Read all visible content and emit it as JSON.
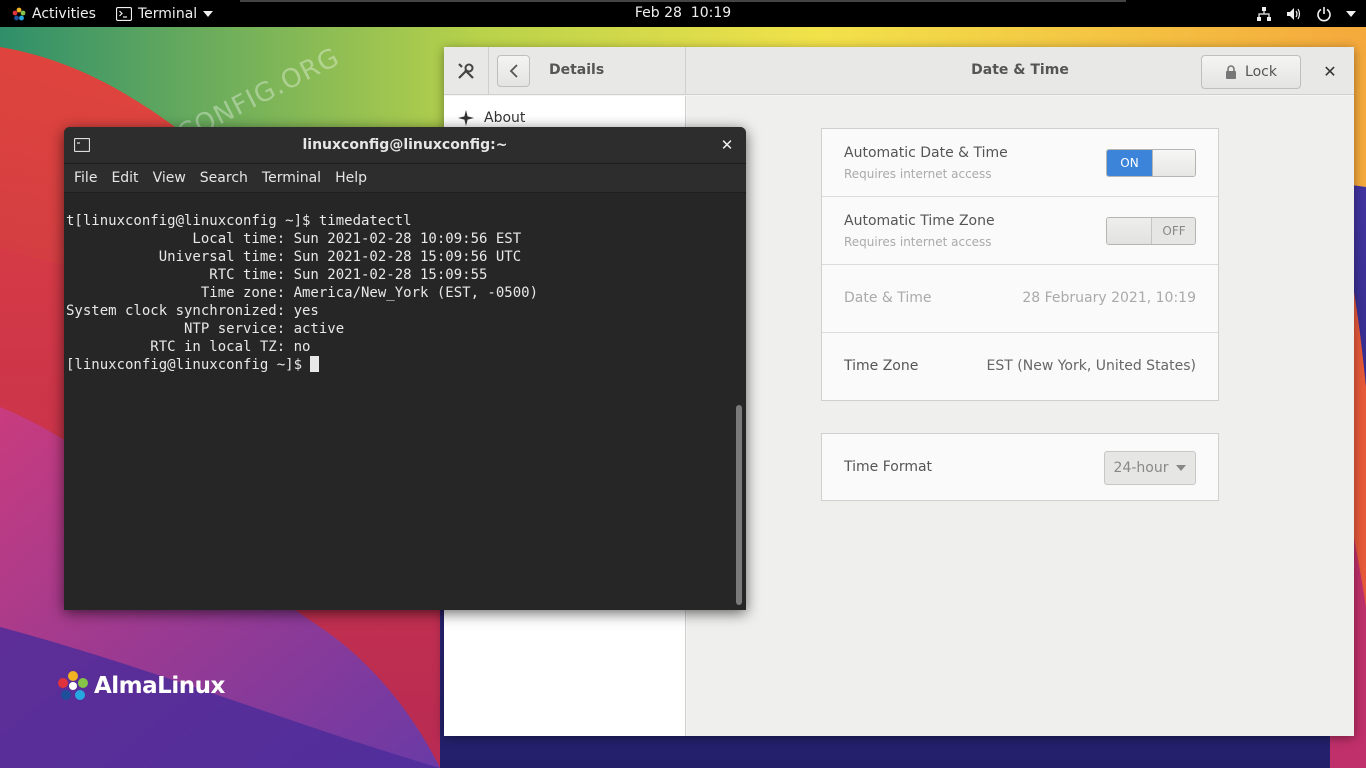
{
  "topbar": {
    "activities_label": "Activities",
    "app_menu_label": "Terminal",
    "clock": "Feb 28  10:19",
    "tray_icons": [
      "network-icon",
      "volume-icon",
      "power-icon"
    ]
  },
  "settings": {
    "sidebar_title": "Details",
    "page_title": "Date & Time",
    "lock_label": "Lock",
    "sidebar_items": [
      {
        "label": "About"
      }
    ],
    "rows": {
      "auto_datetime": {
        "label": "Automatic Date & Time",
        "sub": "Requires internet access",
        "state": "ON"
      },
      "auto_timezone": {
        "label": "Automatic Time Zone",
        "sub": "Requires internet access",
        "state": "OFF"
      },
      "datetime": {
        "label": "Date & Time",
        "value": "28 February 2021, 10:19"
      },
      "timezone": {
        "label": "Time Zone",
        "value": "EST (New York, United States)"
      }
    },
    "time_format": {
      "label": "Time Format",
      "value": "24-hour"
    }
  },
  "terminal": {
    "title": "linuxconfig@linuxconfig:~",
    "menu": [
      "File",
      "Edit",
      "View",
      "Search",
      "Terminal",
      "Help"
    ],
    "lines": [
      "t[linuxconfig@linuxconfig ~]$ timedatectl",
      "               Local time: Sun 2021-02-28 10:09:56 EST",
      "           Universal time: Sun 2021-02-28 15:09:56 UTC",
      "                 RTC time: Sun 2021-02-28 15:09:55",
      "                Time zone: America/New_York (EST, -0500)",
      "System clock synchronized: yes",
      "              NTP service: active",
      "          RTC in local TZ: no"
    ],
    "prompt": "[linuxconfig@linuxconfig ~]$ "
  },
  "desktop": {
    "logo_text": "AlmaLinux",
    "watermark": "LINUXCONFIG.ORG"
  },
  "colors": {
    "accent": "#3b84d9",
    "terminal_bg": "#262626",
    "topbar_bg": "#000000"
  }
}
